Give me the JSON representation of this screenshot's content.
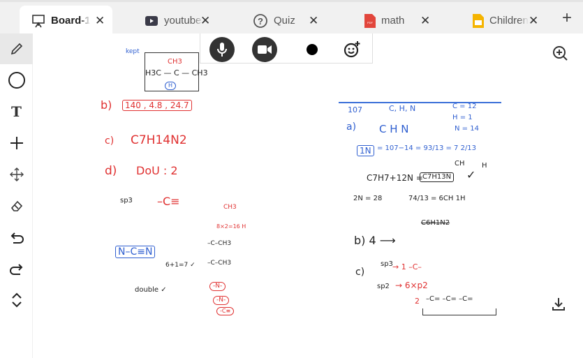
{
  "tabs": [
    {
      "label": "Board-1",
      "icon": "whiteboard-icon",
      "active": true
    },
    {
      "label": "youtube",
      "icon": "youtube-icon"
    },
    {
      "label": "Quiz",
      "icon": "help-circle-icon"
    },
    {
      "label": "math",
      "icon": "pdf-icon",
      "color": "#e2463c"
    },
    {
      "label": "Children",
      "icon": "slides-icon",
      "color": "#f5b400"
    }
  ],
  "tools": [
    "pencil",
    "circle",
    "text",
    "plus",
    "move",
    "eraser",
    "undo",
    "redo",
    "collapse"
  ],
  "media": [
    "microphone",
    "camera",
    "record-dot",
    "emoji-add"
  ],
  "colors": {
    "red": "#e03131",
    "blue": "#2f5fd0",
    "black": "#222"
  },
  "annotations": [
    {
      "text": "kept",
      "color": "blue"
    },
    {
      "text": "CH3",
      "color": "red"
    },
    {
      "text": "H3C — C — CH3",
      "color": "black"
    },
    {
      "text": "H",
      "color": "blue"
    },
    {
      "text": "b)",
      "color": "red"
    },
    {
      "text": "140 , 4.8 , 24.7",
      "color": "red"
    },
    {
      "text": "c)",
      "color": "red"
    },
    {
      "text": "C7H14N2",
      "color": "red"
    },
    {
      "text": "d)",
      "color": "red"
    },
    {
      "text": "DoU : 2",
      "color": "red"
    },
    {
      "text": "–C≡",
      "color": "red"
    },
    {
      "text": "CH3",
      "color": "red"
    },
    {
      "text": "8×2=16 H",
      "color": "red"
    },
    {
      "text": "sp3",
      "color": "black"
    },
    {
      "text": "N–C≡N",
      "color": "blue"
    },
    {
      "text": "6+1=7 ✓",
      "color": "black"
    },
    {
      "text": "double ✓",
      "color": "black"
    },
    {
      "text": "–C–CH3",
      "color": "black"
    },
    {
      "text": "–C–CH3",
      "color": "black"
    },
    {
      "text": "-N-",
      "color": "red"
    },
    {
      "text": "-N-",
      "color": "red"
    },
    {
      "text": "-C≡",
      "color": "red"
    },
    {
      "text": "107",
      "color": "blue"
    },
    {
      "text": "C, H, N",
      "color": "blue"
    },
    {
      "text": "C = 12",
      "color": "blue"
    },
    {
      "text": "H = 1",
      "color": "blue"
    },
    {
      "text": "N = 14",
      "color": "blue"
    },
    {
      "text": "a)",
      "color": "blue"
    },
    {
      "text": "C  H  N",
      "color": "blue"
    },
    {
      "text": "1N",
      "color": "blue"
    },
    {
      "text": "= 107−14 = 93/13 = 7   2/13",
      "color": "blue"
    },
    {
      "text": "CH",
      "color": "black"
    },
    {
      "text": "H",
      "color": "black"
    },
    {
      "text": "C7H7+12N =",
      "color": "black"
    },
    {
      "text": "C7H13N",
      "color": "black"
    },
    {
      "text": "✓",
      "color": "black"
    },
    {
      "text": "2N = 28",
      "color": "black"
    },
    {
      "text": "74/13 = 6CH   1H",
      "color": "black"
    },
    {
      "text": "C6H1N2",
      "color": "black"
    },
    {
      "text": "b)  4 ⟶",
      "color": "black"
    },
    {
      "text": "c)",
      "color": "black"
    },
    {
      "text": "sp3",
      "color": "black"
    },
    {
      "text": "→ 1  –C–",
      "color": "red"
    },
    {
      "text": "sp2",
      "color": "black"
    },
    {
      "text": "→ 6×p2",
      "color": "red"
    },
    {
      "text": "2",
      "color": "red"
    },
    {
      "text": "–C=   –C=   –C=",
      "color": "black"
    }
  ]
}
